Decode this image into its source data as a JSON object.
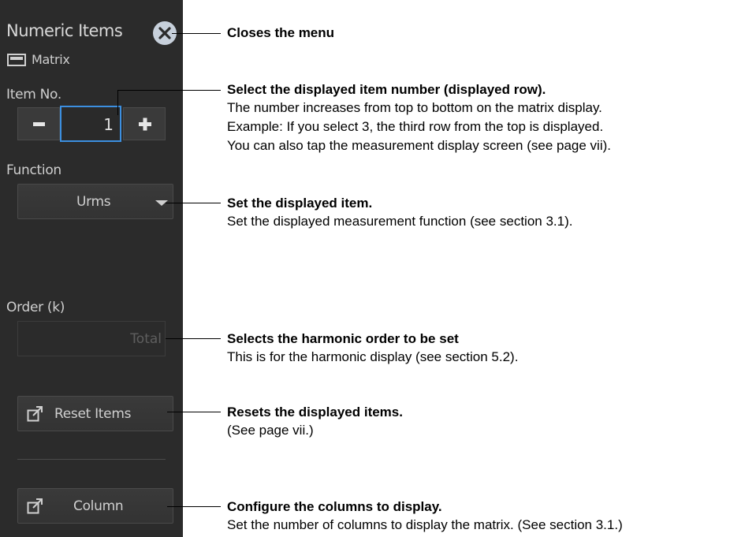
{
  "panel": {
    "title": "Numeric Items",
    "mode_label": "Matrix",
    "item_no_label": "Item No.",
    "item_no_value": "1",
    "minus_symbol": "−",
    "plus_symbol": "+",
    "function_label": "Function",
    "function_value": "Urms",
    "order_label": "Order (k)",
    "order_value": "Total",
    "reset_button_label": "Reset Items",
    "column_button_label": "Column"
  },
  "annotations": {
    "close": {
      "title": "Closes the menu"
    },
    "item_no": {
      "title": "Select the displayed item number (displayed row).",
      "lines": [
        "The number increases from top to bottom on the matrix display.",
        "Example: If you select 3, the third row from the top is displayed.",
        "You can also tap the measurement display screen (see page vii)."
      ]
    },
    "function": {
      "title": "Set the displayed item.",
      "lines": [
        "Set the displayed measurement function (see section 3.1)."
      ]
    },
    "order": {
      "title": "Selects the harmonic order to be set",
      "lines": [
        "This is for the harmonic display (see section 5.2)."
      ]
    },
    "reset": {
      "title": "Resets the displayed items.",
      "lines": [
        "(See page vii.)"
      ]
    },
    "column": {
      "title": "Configure the columns to display.",
      "lines": [
        "Set the number of columns to display the matrix. (See section 3.1.)"
      ]
    }
  },
  "icons": [
    "close-icon",
    "matrix-icon",
    "minus-icon",
    "plus-icon",
    "dropdown-arrow-icon",
    "external-link-icon"
  ],
  "colors": {
    "panel_bg": "#2b2b2b",
    "focus_border": "#3c8fe0",
    "close_circle": "#c7d0db"
  }
}
